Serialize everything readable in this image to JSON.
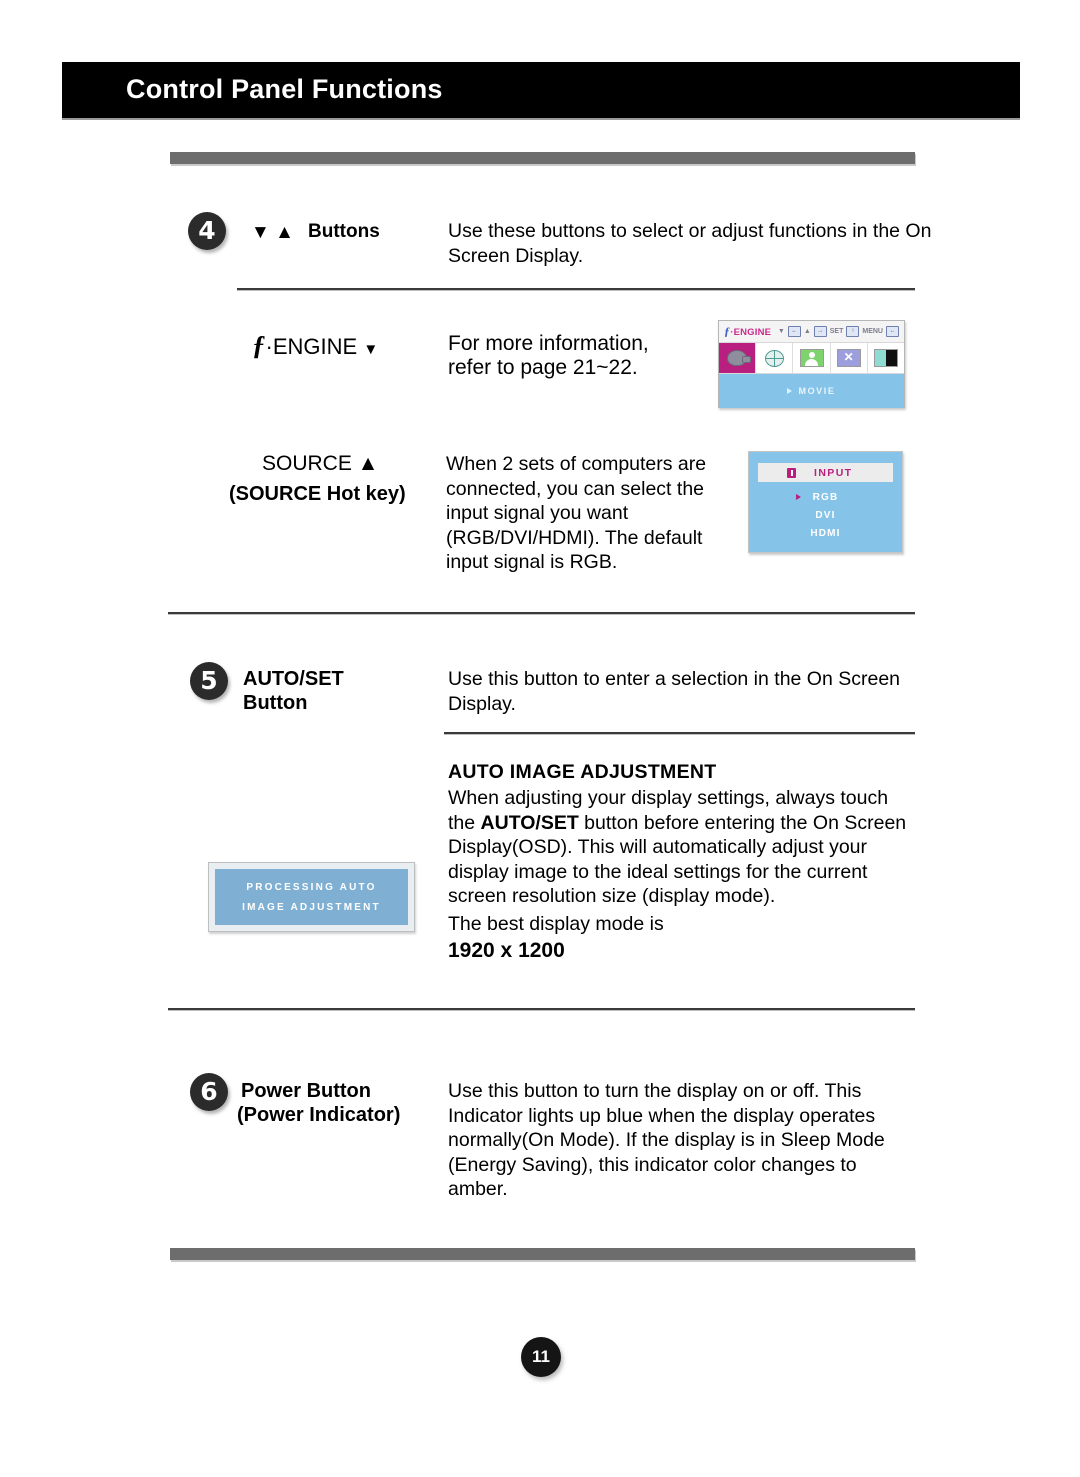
{
  "header": {
    "title": "Control Panel Functions"
  },
  "sections": [
    {
      "badge": "4",
      "label_arrows": "▼  ▲",
      "label": "Buttons",
      "description": "Use these buttons to select or adjust functions in the On Screen Display."
    },
    {
      "fengine_mark": "ENGINE",
      "fengine_f": "ƒ",
      "fengine_dot": "·",
      "fengine_arrow": "▼",
      "description_line1": "For more information,",
      "description_line2": "refer to page 21~22.",
      "osd": {
        "title": "ENGINE",
        "title_f": "ƒ",
        "title_dot": "·",
        "keys": {
          "down_arrow": "▼",
          "down_key": "←",
          "up_arrow": "▲",
          "up_key": "→",
          "set_label": "SET",
          "set_key": "↑",
          "menu_label": "MENU",
          "menu_key": "←"
        },
        "icons": [
          "movie-icon",
          "internet-icon",
          "user-icon",
          "normal-x-icon",
          "demo-contrast-icon"
        ],
        "selected_mode": "MOVIE"
      }
    },
    {
      "label_line1": "SOURCE ▲",
      "label_line2": "(SOURCE Hot key)",
      "description": "When 2 sets of computers are connected, you can select the input signal you want (RGB/DVI/HDMI). The default input signal is RGB.",
      "osd": {
        "title": "INPUT",
        "options": [
          "RGB",
          "DVI",
          "HDMI"
        ],
        "selected": "RGB"
      }
    },
    {
      "badge": "5",
      "label_line1": "AUTO/SET",
      "label_line2": "Button",
      "description": "Use this button to enter a selection in the On Screen Display.",
      "sub_heading": "AUTO IMAGE ADJUSTMENT",
      "sub_body_pre": "When adjusting your display settings, always touch the ",
      "sub_body_strong": "AUTO/SET",
      "sub_body_post": " button before entering the On Screen Display(OSD). This will automatically adjust your display image to the ideal settings for the current screen resolution size (display mode).",
      "best_mode_text": "The best display mode is",
      "best_mode_value": "1920 x 1200",
      "processing_box": {
        "line1": "PROCESSING AUTO",
        "line2": "IMAGE ADJUSTMENT"
      }
    },
    {
      "badge": "6",
      "label_line1": "Power Button",
      "label_line2": "(Power Indicator)",
      "description": "Use this button to turn the display on or off. This Indicator lights up blue when the display operates normally(On Mode). If the display is in Sleep Mode (Energy Saving), this indicator color changes to amber."
    }
  ],
  "footer": {
    "page_number": "11"
  },
  "colors": {
    "header_bg": "#000000",
    "rule_gray": "#6d6d6d",
    "osd_blue": "#85c4e8",
    "osd_magenta": "#b81f7e",
    "processing_blue": "#7fb0d4"
  }
}
